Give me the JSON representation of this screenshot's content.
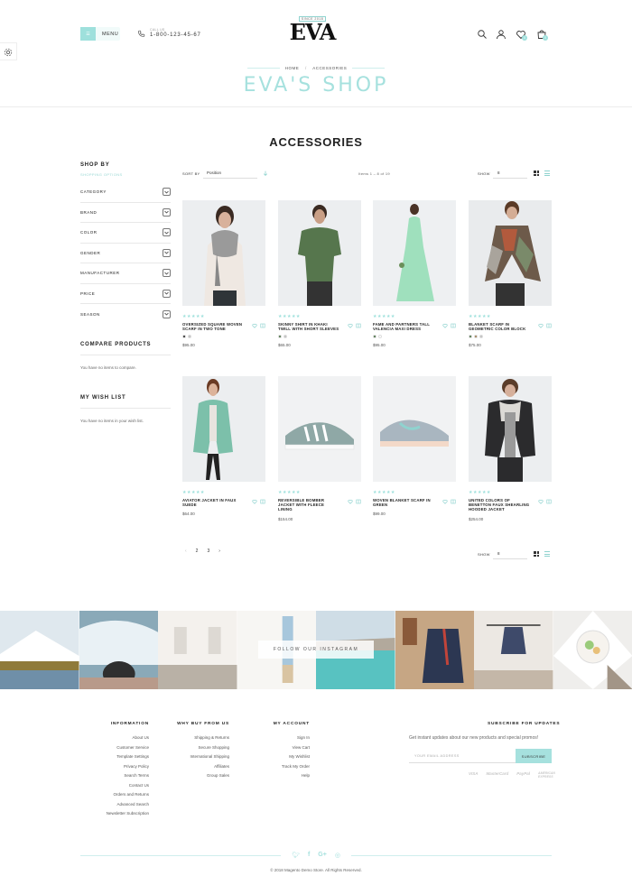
{
  "header": {
    "menu_label": "MENU",
    "phone_label": "CALL US",
    "phone_number": "1-800-123-45-67",
    "logo_tagline": "SINCE 2018",
    "logo_text": "EVA",
    "wishlist_count": "0",
    "cart_count": "0"
  },
  "breadcrumb": {
    "home": "HOME",
    "current": "ACCESSORIES"
  },
  "shop_title": "EVA'S SHOP",
  "page_title": "ACCESSORIES",
  "sidebar": {
    "shop_by": "SHOP BY",
    "shopping_options": "SHOPPING OPTIONS",
    "filters": [
      "CATEGORY",
      "BRAND",
      "COLOR",
      "GENDER",
      "MANUFACTURER",
      "PRICE",
      "SEASON"
    ],
    "compare_title": "COMPARE PRODUCTS",
    "compare_note": "You have no items to compare.",
    "wishlist_title": "MY WISH LIST",
    "wishlist_note": "You have no items in your wish list."
  },
  "toolbar": {
    "sort_label": "SORT BY",
    "sort_value": "Position",
    "items_text": "Items 1 – 8 of 19",
    "show_label": "SHOW",
    "show_value": "8"
  },
  "products": [
    {
      "name": "OVERSIZED SQUARE WOVEN SCARF IN TWO TONE",
      "price": "$95.00",
      "swatches": [
        "#222222",
        "#bfbfbf"
      ]
    },
    {
      "name": "SKINNY SHIRT IN KHAKI TWILL WITH SHORT SLEEVES",
      "price": "$65.00",
      "swatches": [
        "#3f6b3a",
        "#bfbfbf"
      ]
    },
    {
      "name": "FAME AND PARTNERS TALL VALENCIA MAXI DRESS",
      "price": "$95.00",
      "swatches": [
        "#3f6b3a",
        "#ffffff"
      ]
    },
    {
      "name": "BLANKET SCARF IN GEOMETRIC COLOR BLOCK",
      "price": "$75.00",
      "swatches": [
        "#3f6b3a",
        "#9c7a4a",
        "#bfbfbf"
      ]
    },
    {
      "name": "AVIATOR JACKET IN FAUX SUEDE",
      "price": "$64.00",
      "swatches": []
    },
    {
      "name": "REVERSIBLE BOMBER JACKET WITH FLEECE LINING",
      "price": "$154.00",
      "swatches": []
    },
    {
      "name": "WOVEN BLANKET SCARF IN GREEN",
      "price": "$99.00",
      "swatches": []
    },
    {
      "name": "UNITED COLORS OF BENETTON FAUX SHEARLING HOODED JACKET",
      "price": "$254.00",
      "swatches": []
    }
  ],
  "pager": {
    "prev": "‹",
    "pages": [
      "2",
      "3"
    ],
    "next": "›"
  },
  "instagram": {
    "button_label": "FOLLOW OUR INSTAGRAM"
  },
  "footer": {
    "information": {
      "title": "INFORMATION",
      "links": [
        "About Us",
        "Customer Service",
        "Template Settings",
        "Privacy Policy",
        "Search Terms",
        "Contact Us",
        "Orders and Returns",
        "Advanced Search",
        "Newsletter Subscription"
      ]
    },
    "why_buy": {
      "title": "WHY BUY FROM US",
      "links": [
        "Shipping & Returns",
        "Secure Shopping",
        "International Shipping",
        "Affiliates",
        "Group Sales"
      ]
    },
    "account": {
      "title": "MY ACCOUNT",
      "links": [
        "Sign In",
        "View Cart",
        "My Wishlist",
        "Track My Order",
        "Help"
      ]
    },
    "subscribe": {
      "title": "SUBSCRIBE FOR UPDATES",
      "text": "Get instant updates about our new products and special promos!",
      "placeholder": "YOUR EMAIL ADDRESS",
      "button": "SUBSCRIBE"
    },
    "payments": [
      "VISA",
      "MasterCard",
      "PayPal",
      "AMERICAN EXPRESS"
    ],
    "copyright": "© 2018 Magento Demo Store. All Rights Reserved."
  },
  "colors": {
    "accent": "#9ee0dc",
    "title": "#a6e1de"
  }
}
